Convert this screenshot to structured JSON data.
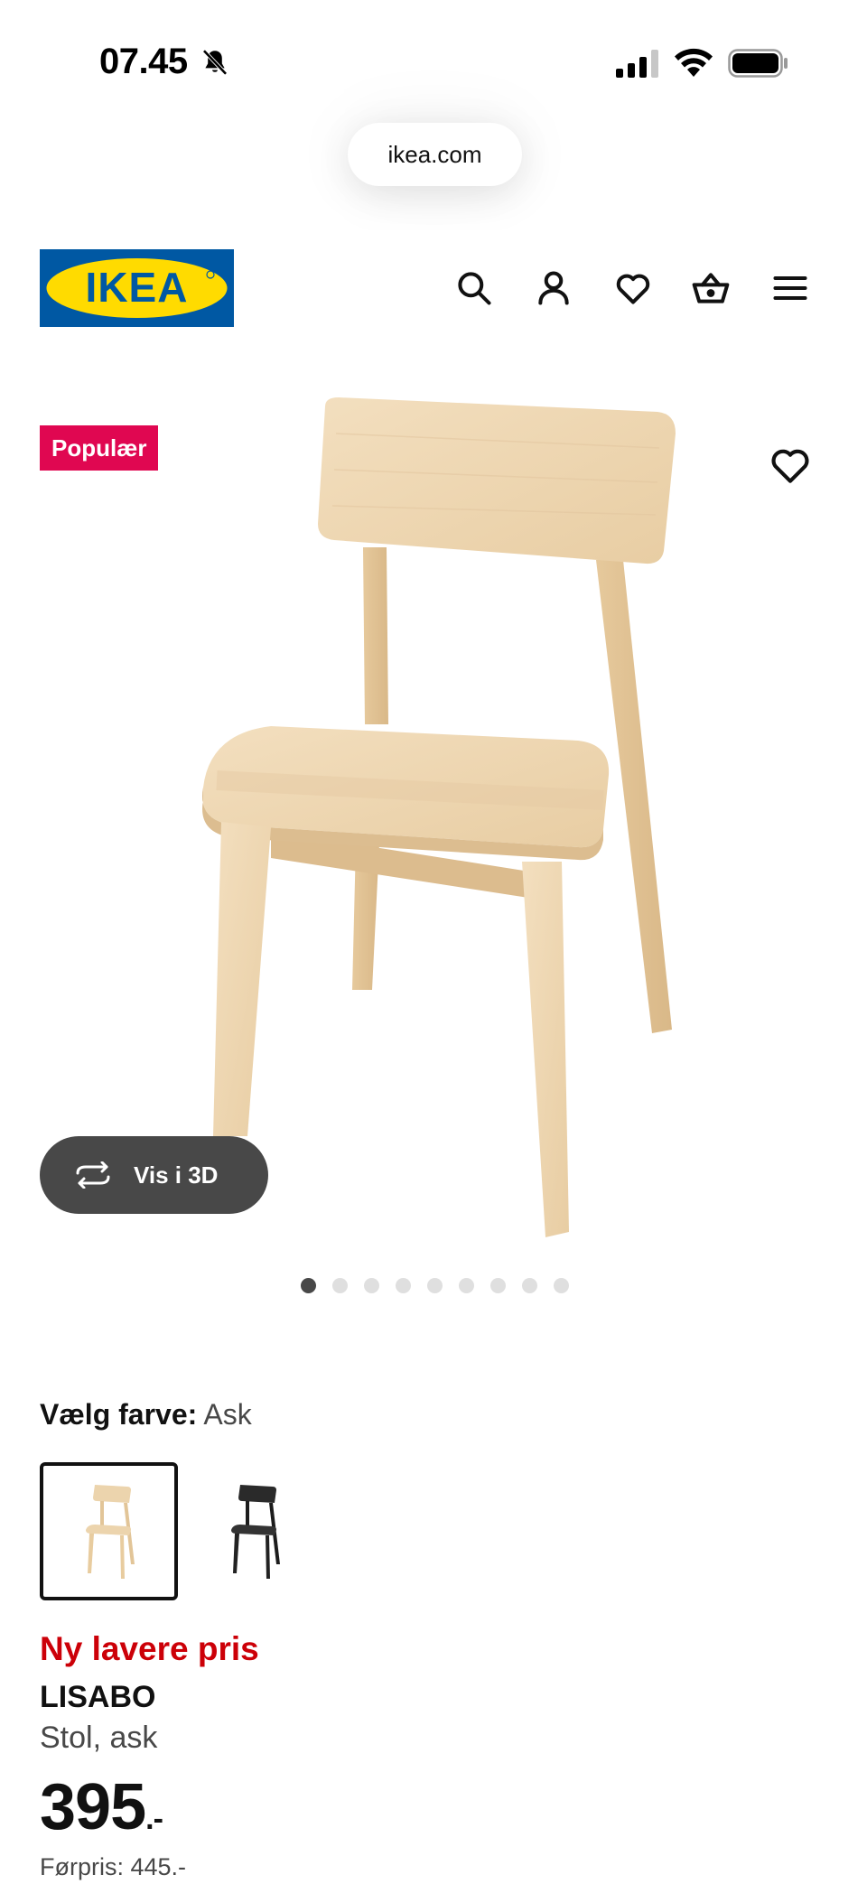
{
  "status_bar": {
    "time": "07.45",
    "icons": [
      "bell-muted-icon",
      "signal-icon",
      "wifi-icon",
      "battery-icon"
    ]
  },
  "browser": {
    "url": "ikea.com"
  },
  "header": {
    "logo_text": "IKEA",
    "icons": [
      "search-icon",
      "account-icon",
      "heart-icon",
      "basket-icon",
      "menu-icon"
    ]
  },
  "product_gallery": {
    "badge": "Populær",
    "view3d_label": "Vis i 3D",
    "dot_count": 9,
    "active_dot": 1
  },
  "colour": {
    "label": "Vælg farve:",
    "value": "Ask",
    "options": [
      "Ask",
      "Sort"
    ]
  },
  "product": {
    "promo": "Ny lavere pris",
    "name": "LISABO",
    "description": "Stol, ask",
    "price": "395",
    "price_suffix": ".-",
    "previous_price": "Førpris: 445.-"
  },
  "colors": {
    "ikea_blue": "#0058a3",
    "ikea_yellow": "#ffdb00",
    "promo_red": "#cc0008",
    "badge_pink": "#e00751",
    "button_dark": "#484848"
  }
}
